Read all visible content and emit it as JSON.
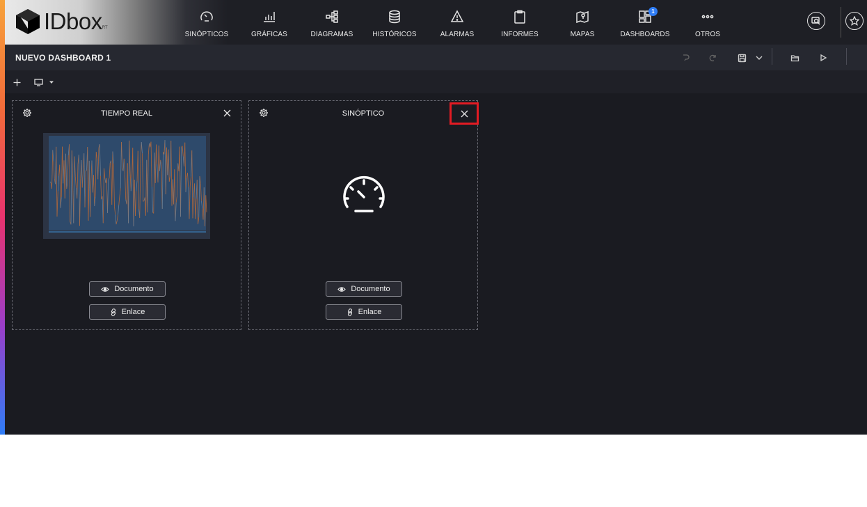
{
  "brand": {
    "name": "IDbox",
    "suffix": "RT"
  },
  "nav": [
    {
      "label": "SINÓPTICOS",
      "icon": "gauge-icon"
    },
    {
      "label": "GRÁFICAS",
      "icon": "bar-chart-icon"
    },
    {
      "label": "DIAGRAMAS",
      "icon": "diagram-icon"
    },
    {
      "label": "HISTÓRICOS",
      "icon": "database-icon"
    },
    {
      "label": "ALARMAS",
      "icon": "warning-icon"
    },
    {
      "label": "INFORMES",
      "icon": "clipboard-icon"
    },
    {
      "label": "MAPAS",
      "icon": "map-icon"
    },
    {
      "label": "DASHBOARDS",
      "icon": "dashboard-icon",
      "badge": "1"
    },
    {
      "label": "OTROS",
      "icon": "more-icon"
    }
  ],
  "dashboard": {
    "title": "NUEVO DASHBOARD 1"
  },
  "widgets": [
    {
      "title": "TIEMPO REAL",
      "document_label": "Documento",
      "link_label": "Enlace"
    },
    {
      "title": "SINÓPTICO",
      "document_label": "Documento",
      "link_label": "Enlace"
    }
  ],
  "colors": {
    "accent": "#2f7df6",
    "highlight": "#e31b23",
    "background": "#1a1b21"
  }
}
